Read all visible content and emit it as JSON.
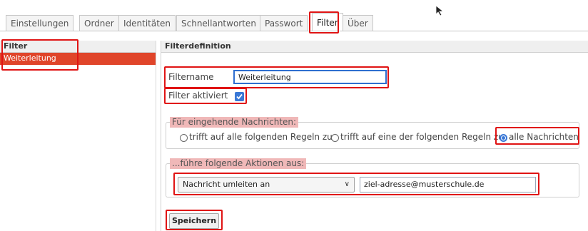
{
  "tabs": [
    {
      "label": "Einstellungen"
    },
    {
      "label": "Ordner"
    },
    {
      "label": "Identitäten"
    },
    {
      "label": "Schnellantworten"
    },
    {
      "label": "Passwort"
    },
    {
      "label": "Filter"
    },
    {
      "label": "Über"
    }
  ],
  "active_tab": "Filter",
  "left_panel": {
    "header": "Filter",
    "items": [
      {
        "label": "Weiterleitung",
        "selected": true
      }
    ]
  },
  "right_panel": {
    "header": "Filterdefinition",
    "filtername_label": "Filtername",
    "filtername_value": "Weiterleitung",
    "enabled_label": "Filter aktiviert",
    "enabled": true,
    "incoming_legend": "Für eingehende Nachrichten:",
    "radio_options": [
      {
        "label": "trifft auf alle folgenden Regeln zu",
        "selected": false
      },
      {
        "label": "trifft auf eine der folgenden Regeln zu",
        "selected": false
      },
      {
        "label": "alle Nachrichten",
        "selected": true
      }
    ],
    "actions_legend": "...führe folgende Aktionen aus:",
    "action_select": "Nachricht umleiten an",
    "action_target": "ziel-adresse@musterschule.de",
    "save_label": "Speichern"
  },
  "colors": {
    "accent": "#e0452a",
    "highlight_box": "#e01414",
    "legend_bg": "#f0b8b8",
    "checkbox": "#3a78d6"
  }
}
